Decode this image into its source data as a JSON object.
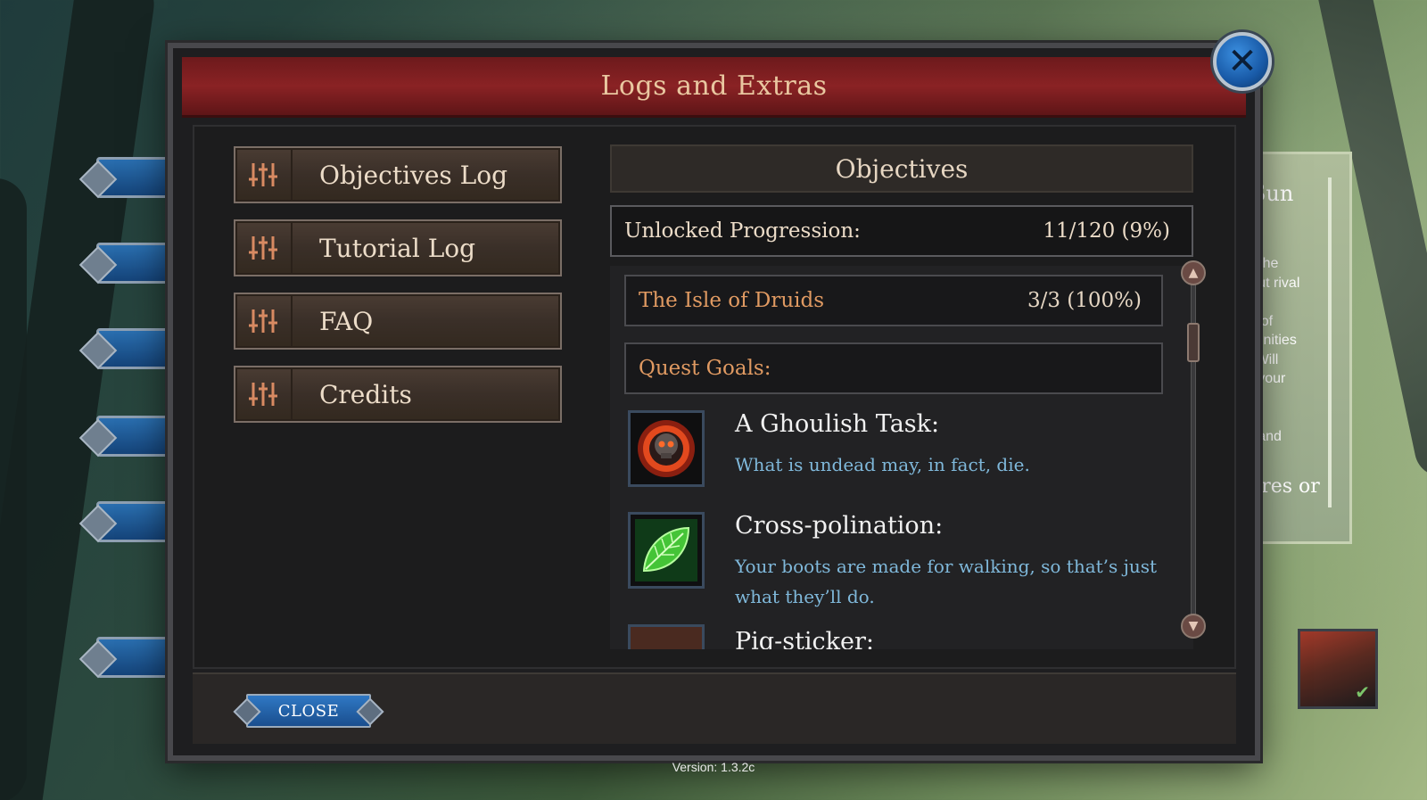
{
  "modal": {
    "title": "Logs and Extras"
  },
  "menu": {
    "items": [
      {
        "label": "Objectives Log",
        "icon": "sliders-icon"
      },
      {
        "label": "Tutorial Log",
        "icon": "sliders-icon"
      },
      {
        "label": "FAQ",
        "icon": "sliders-icon"
      },
      {
        "label": "Credits",
        "icon": "sliders-icon"
      }
    ]
  },
  "objectives": {
    "header": "Objectives",
    "progress_label": "Unlocked Progression:",
    "progress_value": "11/120 (9%)",
    "region_name": "The Isle of Druids",
    "region_value": "3/3 (100%)",
    "goals_label": "Quest Goals:",
    "quests": [
      {
        "title": "A Ghoulish Task:",
        "description": "What is undead may, in fact, die.",
        "icon": "skull-fire-icon"
      },
      {
        "title": "Cross-polination:",
        "description": "Your boots are made for walking, so that’s just what they’ll do.",
        "icon": "leaf-icon"
      },
      {
        "title": "Pig-sticker:",
        "description": "",
        "icon": "warrior-icon"
      }
    ]
  },
  "footer": {
    "close_label": "CLOSE"
  },
  "side": {
    "title": "g Sun\nble",
    "body": "rule the\nai, but rival\nek to\nmoil of\nportunities\nrer. Will\nake your\n Or\nign's\nlory and",
    "sub": "nieres or"
  },
  "version": "Version: 1.3.2c",
  "colors": {
    "header_red": "#8a2224",
    "accent_orange": "#e09a62",
    "desc_blue": "#7fb8da",
    "button_blue": "#1a4e8e"
  }
}
